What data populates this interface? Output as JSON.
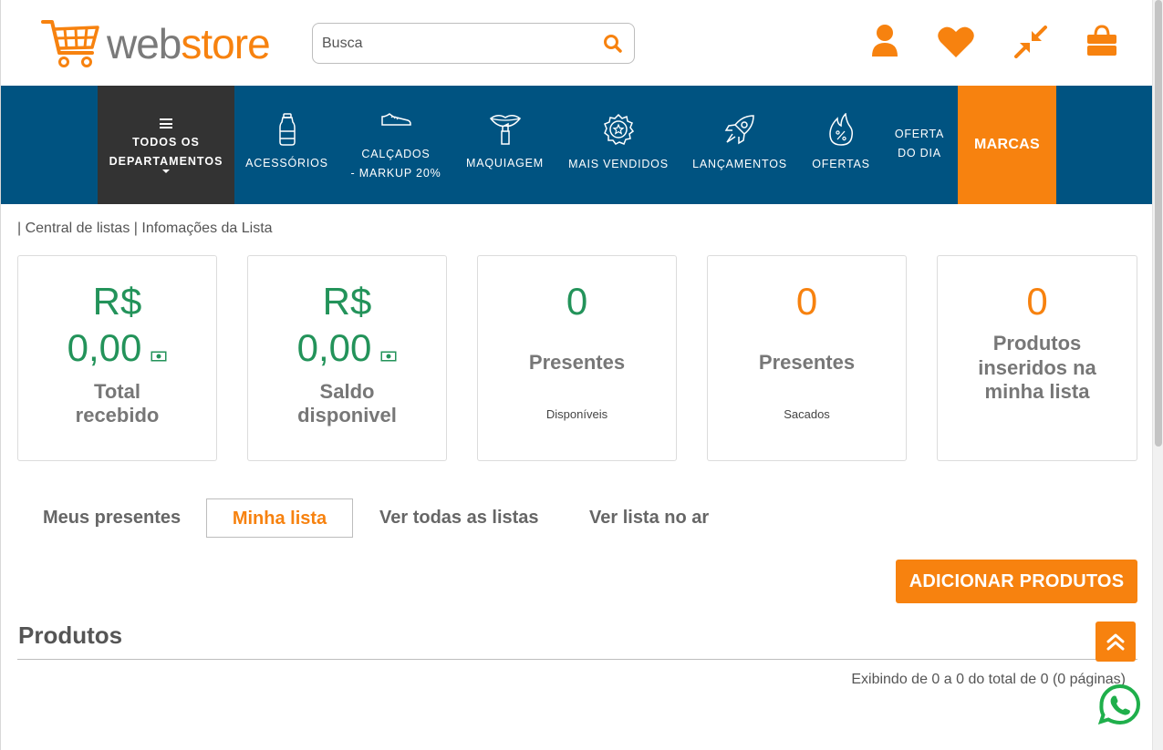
{
  "header": {
    "logo": {
      "part1": "web",
      "part2": "store"
    },
    "search_placeholder": "Busca",
    "icons": [
      "user-icon",
      "heart-icon",
      "compress-icon",
      "shopping-bag-icon"
    ]
  },
  "nav": {
    "all_departments": {
      "line1": "TODOS OS",
      "line2": "DEPARTAMENTOS"
    },
    "items": [
      {
        "label": "ACESSÓRIOS",
        "icon": "bottle-icon"
      },
      {
        "label": "CALÇADOS",
        "label2": "- MARKUP 20%",
        "icon": "sneaker-icon"
      },
      {
        "label": "MAQUIAGEM",
        "icon": "lipstick-icon"
      },
      {
        "label": "MAIS VENDIDOS",
        "icon": "star-badge-icon"
      },
      {
        "label": "LANÇAMENTOS",
        "icon": "rocket-icon"
      },
      {
        "label": "OFERTAS",
        "icon": "flame-percent-icon"
      },
      {
        "label": "OFERTA",
        "label2": "DO DIA"
      }
    ],
    "brands_label": "MARCAS"
  },
  "breadcrumb": "| Central de listas | Infomações da Lista",
  "cards": [
    {
      "currency": "R$",
      "value": "0,00",
      "title1": "Total",
      "title2": "recebido"
    },
    {
      "currency": "R$",
      "value": "0,00",
      "title1": "Saldo",
      "title2": "disponivel"
    },
    {
      "value": "0",
      "title": "Presentes",
      "sub": "Disponíveis"
    },
    {
      "value": "0",
      "title": "Presentes",
      "sub": "Sacados"
    },
    {
      "value": "0",
      "title1": "Produtos",
      "title2": "inseridos na",
      "title3": "minha lista"
    }
  ],
  "tabs": [
    "Meus presentes",
    "Minha lista",
    "Ver todas as listas",
    "Ver lista no ar"
  ],
  "active_tab": "Minha lista",
  "add_products_label": "ADICIONAR PRODUTOS",
  "products_title": "Produtos",
  "paging_text": "Exibindo de 0 a 0 do total de 0 (0 páginas)",
  "colors": {
    "brand_orange": "#f7820f",
    "nav_blue": "#005381",
    "dark": "#333333",
    "green": "#23935a"
  }
}
